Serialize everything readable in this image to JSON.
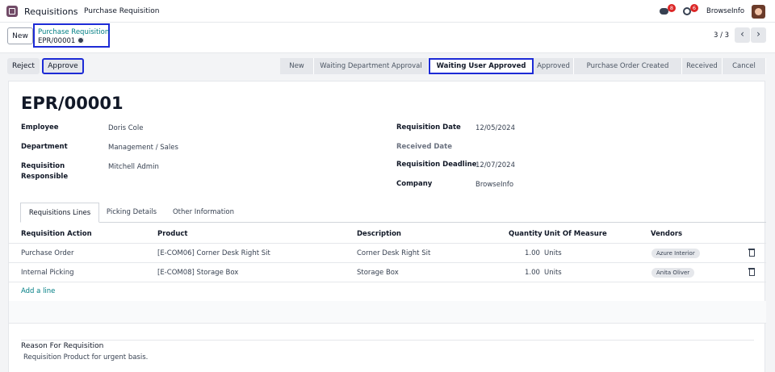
{
  "topnav": {
    "app_title": "Requisitions",
    "menu": [
      "Purchase Requisition"
    ],
    "chat_badge": "8",
    "activity_badge": "6",
    "company": "BrowseInfo"
  },
  "control": {
    "new_label": "New",
    "breadcrumb_link": "Purchase Requisition",
    "breadcrumb_current": "EPR/00001",
    "pager": "3 / 3"
  },
  "statusbar": {
    "reject_label": "Reject",
    "approve_label": "Approve",
    "stages": [
      "New",
      "Waiting Department Approval",
      "Waiting User Approved",
      "Approved",
      "Purchase Order Created",
      "Received",
      "Cancel"
    ],
    "current_stage": "Waiting User Approved"
  },
  "form": {
    "title": "EPR/00001",
    "employee_label": "Employee",
    "employee": "Doris Cole",
    "department_label": "Department",
    "department": "Management / Sales",
    "responsible_label": "Requisition Responsible",
    "responsible": "Mitchell Admin",
    "req_date_label": "Requisition Date",
    "req_date": "12/05/2024",
    "received_date_label": "Received Date",
    "deadline_label": "Requisition Deadline",
    "deadline": "12/07/2024",
    "company_label": "Company",
    "company": "BrowseInfo"
  },
  "tabs": [
    "Requisitions Lines",
    "Picking Details",
    "Other Information"
  ],
  "table": {
    "headers": [
      "Requisition Action",
      "Product",
      "Description",
      "Quantity",
      "Unit Of Measure",
      "Vendors"
    ],
    "rows": [
      {
        "action": "Purchase Order",
        "product": "[E-COM06] Corner Desk Right Sit",
        "description": "Corner Desk Right Sit",
        "quantity": "1.00",
        "uom": "Units",
        "vendor": "Azure Interior"
      },
      {
        "action": "Internal Picking",
        "product": "[E-COM08] Storage Box",
        "description": "Storage Box",
        "quantity": "1.00",
        "uom": "Units",
        "vendor": "Anita Oliver"
      }
    ],
    "add_line": "Add a line"
  },
  "reason": {
    "title": "Reason For Requisition",
    "text": "Requisition Product for urgent basis."
  },
  "colors": {
    "accent": "#017e84",
    "highlight": "#1d2bd6",
    "brand": "#714b67"
  }
}
